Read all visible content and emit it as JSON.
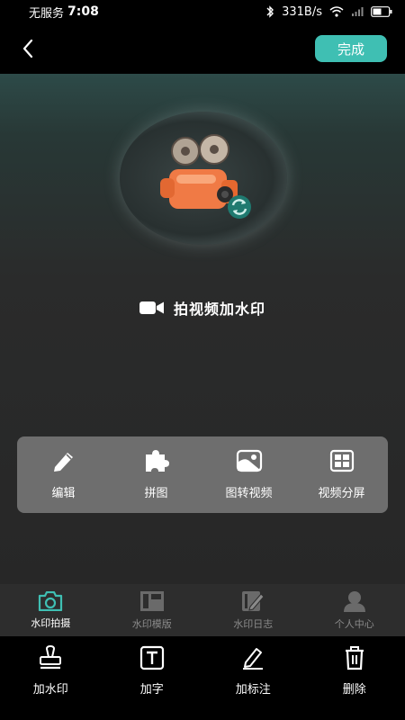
{
  "status": {
    "carrier": "无服务",
    "time": "7:08",
    "speed": "331B/s"
  },
  "header": {
    "done_label": "完成"
  },
  "main": {
    "title": "拍视频加水印"
  },
  "tools": [
    {
      "label": "编辑",
      "icon": "pencil-icon"
    },
    {
      "label": "拼图",
      "icon": "puzzle-icon"
    },
    {
      "label": "图转视频",
      "icon": "image-video-icon"
    },
    {
      "label": "视频分屏",
      "icon": "split-screen-icon"
    }
  ],
  "tabs": [
    {
      "label": "水印拍摄",
      "icon": "camera-icon",
      "active": true
    },
    {
      "label": "水印模版",
      "icon": "template-icon",
      "active": false
    },
    {
      "label": "水印日志",
      "icon": "log-icon",
      "active": false
    },
    {
      "label": "个人中心",
      "icon": "user-icon",
      "active": false
    }
  ],
  "actions": [
    {
      "label": "加水印",
      "icon": "stamp-icon"
    },
    {
      "label": "加字",
      "icon": "text-icon"
    },
    {
      "label": "加标注",
      "icon": "annotate-icon"
    },
    {
      "label": "删除",
      "icon": "trash-icon"
    }
  ],
  "colors": {
    "accent": "#3fbfb3",
    "panel": "#6e6e6e",
    "tab_bar": "#2d2d2d"
  }
}
